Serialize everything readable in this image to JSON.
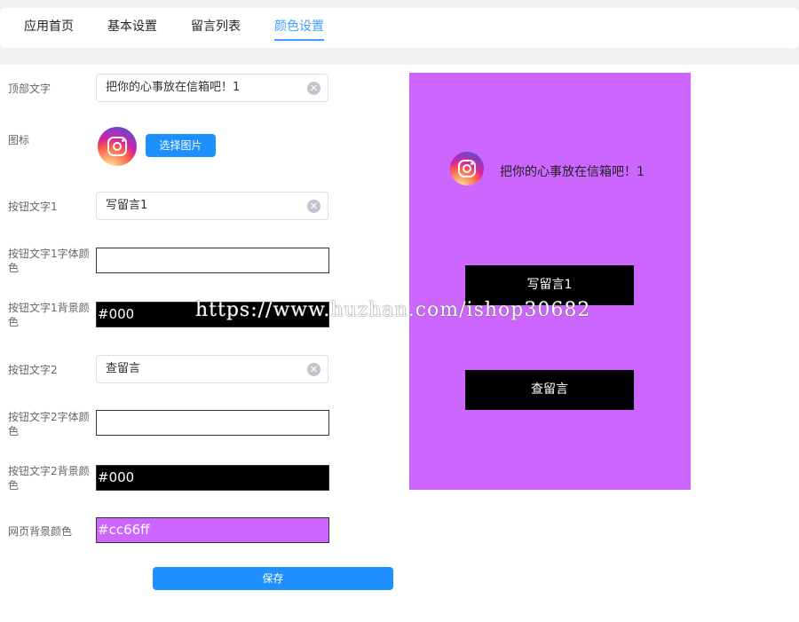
{
  "tabs": [
    {
      "label": "应用首页"
    },
    {
      "label": "基本设置"
    },
    {
      "label": "留言列表"
    },
    {
      "label": "颜色设置"
    }
  ],
  "form": {
    "top_text": {
      "label": "顶部文字",
      "value": "把你的心事放在信箱吧！1"
    },
    "icon": {
      "label": "图标",
      "button": "选择图片"
    },
    "btn1_text": {
      "label": "按钮文字1",
      "value": "写留言1"
    },
    "btn1_color": {
      "label": "按钮文字1字体颜色",
      "value": ""
    },
    "btn1_bg": {
      "label": "按钮文字1背景颜色",
      "value": "#000"
    },
    "btn2_text": {
      "label": "按钮文字2",
      "value": "查留言"
    },
    "btn2_color": {
      "label": "按钮文字2字体颜色",
      "value": ""
    },
    "btn2_bg": {
      "label": "按钮文字2背景颜色",
      "value": "#000"
    },
    "page_bg": {
      "label": "网页背景颜色",
      "value": "#cc66ff"
    },
    "save": "保存"
  },
  "preview": {
    "title": "把你的心事放在信箱吧！1",
    "button1": "写留言1",
    "button2": "查留言",
    "background": "#cc66ff"
  },
  "watermark": "https://www.huzhan.com/ishop30682",
  "icon_name": "instagram-icon",
  "colors": {
    "accent": "#1e8ffe",
    "tab_active": "#409eff",
    "page_bg": "#cc66ff"
  }
}
